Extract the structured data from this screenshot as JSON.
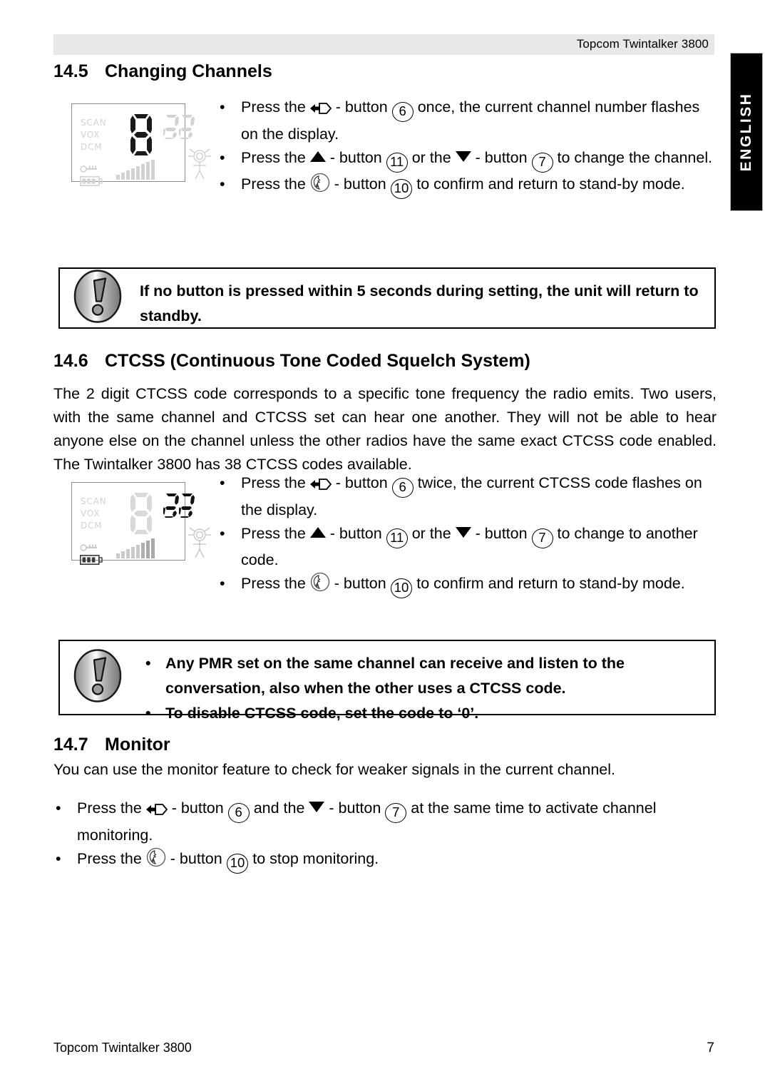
{
  "header": {
    "title": "Topcom Twintalker 3800"
  },
  "side_tab": {
    "label": "ENGLISH"
  },
  "sections": {
    "changing_channels": {
      "number": "14.5",
      "title": "Changing Channels",
      "bullets": [
        {
          "pre": "Press the",
          "icon": "menu-mode-icon",
          "mid": "- button",
          "button_ref": "6",
          "post": "once, the current channel number flashes on the display."
        },
        {
          "pre": "Press the",
          "icon": "triangle-up-icon",
          "mid": "- button",
          "button_ref": "11",
          "conj": "or the",
          "icon2": "triangle-down-icon",
          "mid2": "- button",
          "button_ref2": "7",
          "post": "to change the channel."
        },
        {
          "pre": "Press the",
          "icon": "ptt-call-icon",
          "mid": "- button",
          "button_ref": "10",
          "post": "to confirm and return to stand-by mode."
        }
      ]
    },
    "ctcss": {
      "number": "14.6",
      "title": "CTCSS (Continuous Tone Coded Squelch System)",
      "paragraph": "The 2 digit CTCSS code corresponds to a specific tone frequency the radio emits. Two users, with the same channel and CTCSS set can hear one another. They will not be able to hear anyone else on the channel unless the other radios have the same exact CTCSS code enabled. The Twintalker 3800 has 38 CTCSS codes available.",
      "bullets": [
        {
          "pre": "Press the",
          "icon": "menu-mode-icon",
          "mid": "- button",
          "button_ref": "6",
          "post": "twice, the current CTCSS code flashes on the display."
        },
        {
          "pre": "Press the",
          "icon": "triangle-up-icon",
          "mid": "- button",
          "button_ref": "11",
          "conj": "or the",
          "icon2": "triangle-down-icon",
          "mid2": "- button",
          "button_ref2": "7",
          "post": "to change to another code."
        },
        {
          "pre": "Press the",
          "icon": "ptt-call-icon",
          "mid": "- button",
          "button_ref": "10",
          "post": "to confirm and return to stand-by mode."
        }
      ]
    },
    "monitor": {
      "number": "14.7",
      "title": "Monitor",
      "paragraph": "You can use the monitor feature to check for weaker signals in the current channel.",
      "bullets": [
        {
          "pre": "Press the",
          "icon": "menu-mode-icon",
          "mid": "- button",
          "button_ref": "6",
          "conj": "and the",
          "icon2": "triangle-down-icon",
          "mid2": "- button",
          "button_ref2": "7",
          "post": "at the same time to activate channel monitoring."
        },
        {
          "pre": "Press the",
          "icon": "ptt-call-icon",
          "mid": "- button",
          "button_ref": "10",
          "post": "to stop monitoring."
        }
      ]
    }
  },
  "notes": [
    {
      "icon": "exclamation-icon",
      "text": "If no button is pressed within 5 seconds during setting, the unit will return to standby."
    },
    {
      "icon": "exclamation-icon",
      "items": [
        "Any PMR set on the same channel can receive and listen to the conversation, also when the other uses a CTCSS code.",
        "To disable CTCSS code, set the code to ‘0’."
      ]
    }
  ],
  "lcd_displays": [
    {
      "name": "channel-flashing-display",
      "labels": [
        "SCAN",
        "VOX",
        "DCM"
      ],
      "digit_big": "8",
      "digit_big_state": "active",
      "digit_small": "38",
      "digit_small_state": "inactive",
      "key_icon": "key-lock-icon",
      "battery_icon": "battery-icon",
      "battery_bars": 3,
      "signal_bars": 8,
      "person_icon": "person-transmit-icon"
    },
    {
      "name": "ctcss-flashing-display",
      "labels": [
        "SCAN",
        "VOX",
        "DCM"
      ],
      "digit_big": "8",
      "digit_big_state": "inactive",
      "digit_small": "38",
      "digit_small_state": "active",
      "key_icon": "key-lock-icon",
      "battery_icon": "battery-icon",
      "battery_bars": 3,
      "signal_bars": 8,
      "person_icon": "person-transmit-icon"
    }
  ],
  "footer": {
    "left": "Topcom Twintalker 3800",
    "page_number": "7"
  },
  "colors": {
    "header_band": "#e8e8e8",
    "tab_background": "#000000",
    "tab_text": "#ffffff",
    "lcd_inactive": "#d2d2d2",
    "lcd_active": "#1a1a1a"
  }
}
